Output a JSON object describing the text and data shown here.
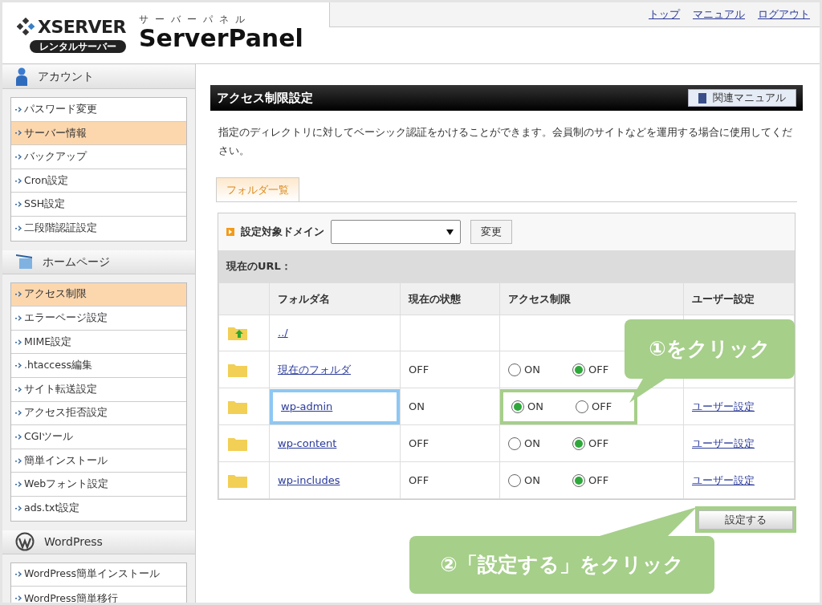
{
  "header": {
    "brand": "XSERVER",
    "badge": "レンタルサーバー",
    "kana": "サーバーパネル",
    "product": "ServerPanel",
    "links": [
      "トップ",
      "マニュアル",
      "ログアウト"
    ]
  },
  "sidebar": {
    "sections": [
      {
        "kind": "account",
        "title": "アカウント",
        "items": [
          {
            "label": "パスワード変更",
            "selected": false
          },
          {
            "label": "サーバー情報",
            "selected": true
          },
          {
            "label": "バックアップ",
            "selected": false
          },
          {
            "label": "Cron設定",
            "selected": false
          },
          {
            "label": "SSH設定",
            "selected": false
          },
          {
            "label": "二段階認証設定",
            "selected": false
          }
        ]
      },
      {
        "kind": "homepage",
        "title": "ホームページ",
        "items": [
          {
            "label": "アクセス制限",
            "selected": true
          },
          {
            "label": "エラーページ設定",
            "selected": false
          },
          {
            "label": "MIME設定",
            "selected": false
          },
          {
            "label": ".htaccess編集",
            "selected": false
          },
          {
            "label": "サイト転送設定",
            "selected": false
          },
          {
            "label": "アクセス拒否設定",
            "selected": false
          },
          {
            "label": "CGIツール",
            "selected": false
          },
          {
            "label": "簡単インストール",
            "selected": false
          },
          {
            "label": "Webフォント設定",
            "selected": false
          },
          {
            "label": "ads.txt設定",
            "selected": false
          }
        ]
      },
      {
        "kind": "wordpress",
        "title": "WordPress",
        "items": [
          {
            "label": "WordPress簡単インストール",
            "selected": false
          },
          {
            "label": "WordPress簡単移行",
            "selected": false
          }
        ]
      }
    ]
  },
  "main": {
    "title": "アクセス制限設定",
    "manual_button": "関連マニュアル",
    "description": "指定のディレクトリに対してベーシック認証をかけることができます。会員制のサイトなどを運用する場合に使用してください。",
    "tabs": [
      {
        "label": "フォルダ一覧",
        "selected": true
      }
    ],
    "domain_label": "設定対象ドメイン",
    "change_button": "変更",
    "url_label": "現在のURL：",
    "columns": [
      "フォルダ名",
      "現在の状態",
      "アクセス制限",
      "ユーザー設定"
    ],
    "rows": [
      {
        "kind": "parent",
        "name": "../",
        "highlighted": false
      },
      {
        "kind": "folder",
        "name": "現在のフォルダ",
        "status": "OFF",
        "highlighted": false,
        "restriction": [
          {
            "label": "ON",
            "selected": false
          },
          {
            "label": "OFF",
            "selected": true
          }
        ]
      },
      {
        "kind": "folder",
        "name": "wp-admin",
        "status": "ON",
        "highlighted": true,
        "restriction": [
          {
            "label": "ON",
            "selected": true
          },
          {
            "label": "OFF",
            "selected": false
          }
        ],
        "user_link": "ユーザー設定"
      },
      {
        "kind": "folder",
        "name": "wp-content",
        "status": "OFF",
        "highlighted": false,
        "restriction": [
          {
            "label": "ON",
            "selected": false
          },
          {
            "label": "OFF",
            "selected": true
          }
        ],
        "user_link": "ユーザー設定"
      },
      {
        "kind": "folder",
        "name": "wp-includes",
        "status": "OFF",
        "highlighted": false,
        "restriction": [
          {
            "label": "ON",
            "selected": false
          },
          {
            "label": "OFF",
            "selected": true
          }
        ],
        "user_link": "ユーザー設定"
      }
    ],
    "submit_button": "設定する",
    "submit_highlighted": true
  },
  "annotations": [
    {
      "text": "①をクリック"
    },
    {
      "text": "②「設定する」をクリック"
    }
  ]
}
